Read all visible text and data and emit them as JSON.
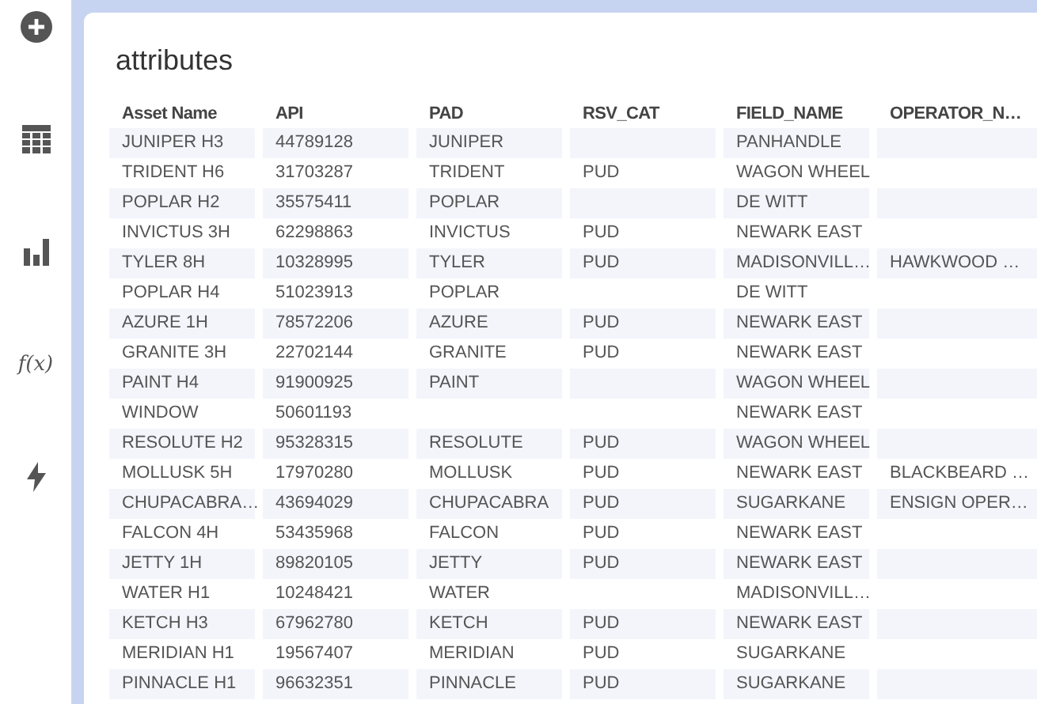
{
  "sidebar": {
    "items": [
      {
        "kind": "add"
      },
      {
        "kind": "table"
      },
      {
        "kind": "chart"
      },
      {
        "kind": "function",
        "label": "f(x)"
      },
      {
        "kind": "flash"
      }
    ]
  },
  "panel": {
    "title": "attributes"
  },
  "table": {
    "columns": [
      "Asset Name",
      "API",
      "PAD",
      "RSV_CAT",
      "FIELD_NAME",
      "OPERATOR_N…"
    ],
    "rows": [
      [
        "JUNIPER H3",
        "44789128",
        "JUNIPER",
        null,
        "PANHANDLE",
        null
      ],
      [
        "TRIDENT H6",
        "31703287",
        "TRIDENT",
        "PUD",
        "WAGON WHEEL",
        null
      ],
      [
        "POPLAR H2",
        "35575411",
        "POPLAR",
        null,
        "DE WITT",
        null
      ],
      [
        "INVICTUS 3H",
        "62298863",
        "INVICTUS",
        "PUD",
        "NEWARK EAST",
        null
      ],
      [
        "TYLER 8H",
        "10328995",
        "TYLER",
        "PUD",
        "MADISONVILL…",
        "HAWKWOOD …"
      ],
      [
        "POPLAR H4",
        "51023913",
        "POPLAR",
        null,
        "DE WITT",
        null
      ],
      [
        "AZURE 1H",
        "78572206",
        "AZURE",
        "PUD",
        "NEWARK EAST",
        null
      ],
      [
        "GRANITE 3H",
        "22702144",
        "GRANITE",
        "PUD",
        "NEWARK EAST",
        null
      ],
      [
        "PAINT H4",
        "91900925",
        "PAINT",
        null,
        "WAGON WHEEL",
        null
      ],
      [
        "WINDOW",
        "50601193",
        null,
        null,
        "NEWARK EAST",
        null
      ],
      [
        "RESOLUTE H2",
        "95328315",
        "RESOLUTE",
        "PUD",
        "WAGON WHEEL",
        null
      ],
      [
        "MOLLUSK 5H",
        "17970280",
        "MOLLUSK",
        "PUD",
        "NEWARK EAST",
        "BLACKBEARD …"
      ],
      [
        "CHUPACABRA…",
        "43694029",
        "CHUPACABRA",
        "PUD",
        "SUGARKANE",
        "ENSIGN OPER…"
      ],
      [
        "FALCON 4H",
        "53435968",
        "FALCON",
        "PUD",
        "NEWARK EAST",
        null
      ],
      [
        "JETTY 1H",
        "89820105",
        "JETTY",
        "PUD",
        "NEWARK EAST",
        null
      ],
      [
        "WATER H1",
        "10248421",
        "WATER",
        null,
        "MADISONVILL…",
        null
      ],
      [
        "KETCH H3",
        "67962780",
        "KETCH",
        "PUD",
        "NEWARK EAST",
        null
      ],
      [
        "MERIDIAN H1",
        "19567407",
        "MERIDIAN",
        "PUD",
        "SUGARKANE",
        null
      ],
      [
        "PINNACLE H1",
        "96632351",
        "PINNACLE",
        "PUD",
        "SUGARKANE",
        null
      ]
    ]
  }
}
